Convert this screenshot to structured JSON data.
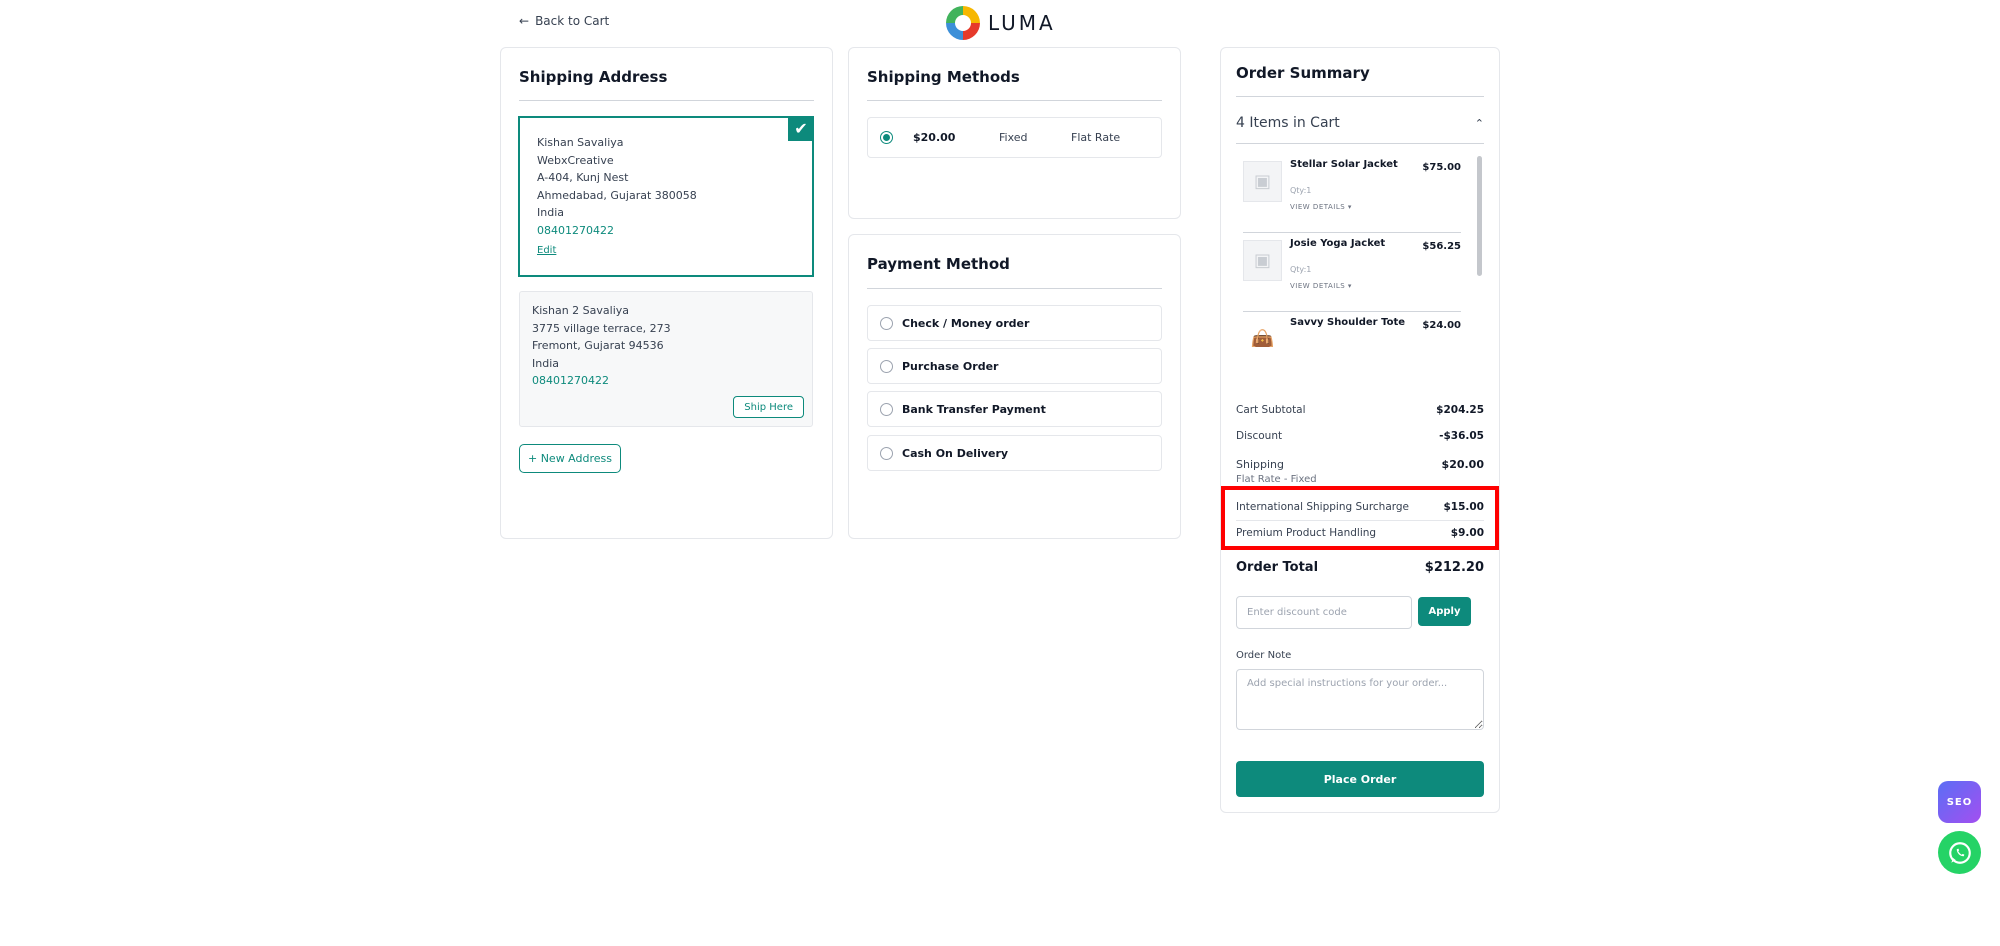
{
  "header": {
    "back_label": "Back to Cart",
    "brand_name": "LUMA"
  },
  "shipping_address": {
    "title": "Shipping Address",
    "selected": {
      "name": "Kishan Savaliya",
      "company": "WebxCreative",
      "street": "A-404, Kunj Nest",
      "city_line": "Ahmedabad, Gujarat 380058",
      "country": "India",
      "phone": "08401270422",
      "edit_label": "Edit"
    },
    "other": {
      "name": "Kishan 2 Savaliya",
      "street": "3775 village terrace, 273",
      "city_line": "Fremont, Gujarat 94536",
      "country": "India",
      "phone": "08401270422",
      "ship_here_label": "Ship Here"
    },
    "new_address_label": "+ New Address"
  },
  "shipping_methods": {
    "title": "Shipping Methods",
    "options": [
      {
        "price": "$20.00",
        "type": "Fixed",
        "name": "Flat Rate",
        "selected": true
      }
    ]
  },
  "payment": {
    "title": "Payment Method",
    "options": [
      "Check / Money order",
      "Purchase Order",
      "Bank Transfer Payment",
      "Cash On Delivery"
    ]
  },
  "summary": {
    "title": "Order Summary",
    "items_count_label": "4 Items in Cart",
    "items": [
      {
        "name": "Stellar Solar Jacket",
        "price": "$75.00",
        "qty": "Qty:1",
        "details": "VIEW DETAILS"
      },
      {
        "name": "Josie Yoga Jacket",
        "price": "$56.25",
        "qty": "Qty:1",
        "details": "VIEW DETAILS"
      },
      {
        "name": "Savvy Shoulder Tote",
        "price": "$24.00"
      }
    ],
    "totals": {
      "subtotal_label": "Cart Subtotal",
      "subtotal": "$204.25",
      "discount_label": "Discount",
      "discount": "-$36.05",
      "shipping_label": "Shipping",
      "shipping": "$20.00",
      "shipping_sub": "Flat Rate - Fixed",
      "surcharge_label": "International Shipping Surcharge",
      "surcharge": "$15.00",
      "handling_label": "Premium Product Handling",
      "handling": "$9.00",
      "order_total_label": "Order Total",
      "order_total": "$212.20"
    },
    "discount_placeholder": "Enter discount code",
    "apply_label": "Apply",
    "note_label": "Order Note",
    "note_placeholder": "Add special instructions for your order...",
    "place_order_label": "Place Order"
  },
  "floating": {
    "seo_label": "SEO"
  },
  "colors": {
    "accent": "#0d8a7c",
    "highlight": "#ff0000"
  }
}
